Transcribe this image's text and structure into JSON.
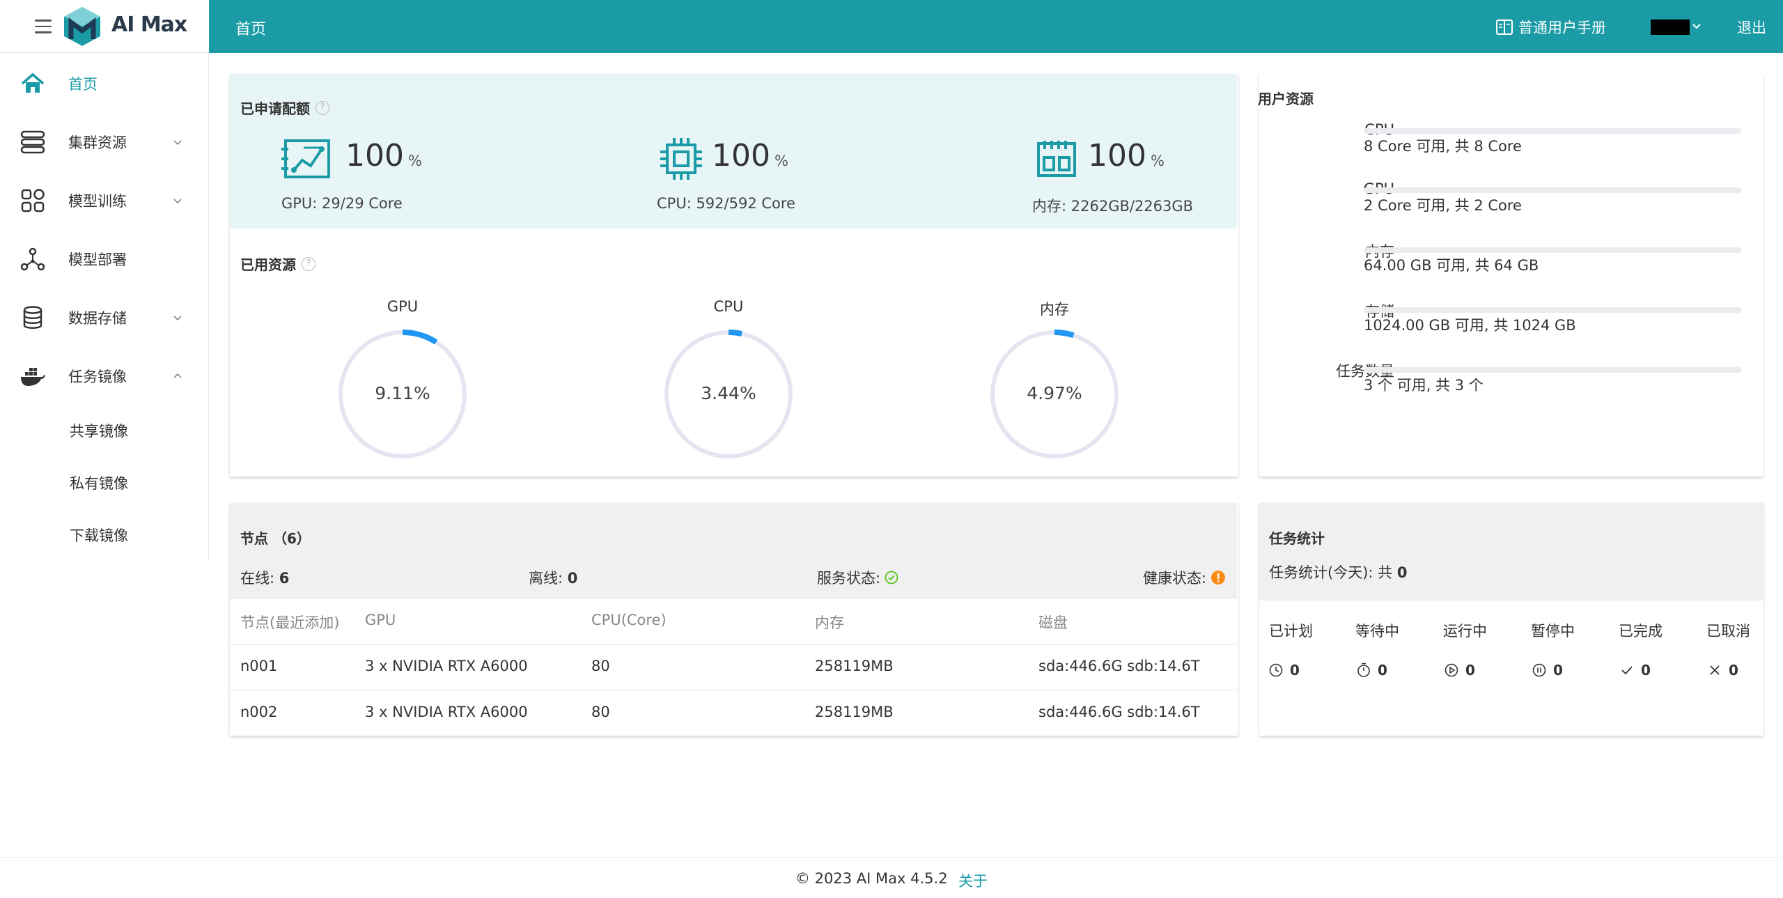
{
  "app": {
    "brand": "AI Max"
  },
  "header": {
    "home": "首页",
    "manual": "普通用户手册",
    "logout": "退出"
  },
  "sidebar": {
    "items": [
      {
        "label": "首页",
        "icon": "home-icon",
        "active": true
      },
      {
        "label": "集群资源",
        "icon": "server-icon"
      },
      {
        "label": "模型训练",
        "icon": "grid-icon"
      },
      {
        "label": "模型部署",
        "icon": "network-icon"
      },
      {
        "label": "数据存储",
        "icon": "database-icon"
      },
      {
        "label": "任务镜像",
        "icon": "docker-icon"
      }
    ],
    "subitems": [
      "共享镜像",
      "私有镜像",
      "下载镜像"
    ]
  },
  "quota": {
    "title": "已申请配额",
    "items": [
      {
        "pct": "100",
        "unit": "%",
        "sub": "GPU: 29/29 Core",
        "icon": "gpu-chart-icon"
      },
      {
        "pct": "100",
        "unit": "%",
        "sub": "CPU: 592/592 Core",
        "icon": "cpu-chip-icon"
      },
      {
        "pct": "100",
        "unit": "%",
        "sub": "内存: 2262GB/2263GB",
        "icon": "memory-icon"
      }
    ]
  },
  "used": {
    "title": "已用资源",
    "gauges": [
      {
        "label": "GPU",
        "value": "9.11%",
        "fraction": 0.0911
      },
      {
        "label": "CPU",
        "value": "3.44%",
        "fraction": 0.0344
      },
      {
        "label": "内存",
        "value": "4.97%",
        "fraction": 0.0497
      }
    ]
  },
  "user_resources": {
    "title": "用户资源",
    "rows": [
      {
        "label": "CPU",
        "text": "8 Core 可用, 共 8 Core"
      },
      {
        "label": "GPU",
        "text": "2 Core 可用, 共 2 Core"
      },
      {
        "label": "内存",
        "text": "64.00 GB 可用, 共 64 GB"
      },
      {
        "label": "存储",
        "text": "1024.00 GB 可用, 共 1024 GB"
      },
      {
        "label": "任务数量",
        "text": "3 个 可用, 共 3 个"
      }
    ]
  },
  "nodes": {
    "title": "节点 （6）",
    "online_label": "在线:",
    "online": "6",
    "offline_label": "离线:",
    "offline": "0",
    "service_label": "服务状态:",
    "health_label": "健康状态:",
    "columns": [
      "节点(最近添加)",
      "GPU",
      "CPU(Core)",
      "内存",
      "磁盘"
    ],
    "rows": [
      [
        "n001",
        "3 x NVIDIA RTX A6000",
        "80",
        "258119MB",
        "sda:446.6G sdb:14.6T"
      ],
      [
        "n002",
        "3 x NVIDIA RTX A6000",
        "80",
        "258119MB",
        "sda:446.6G sdb:14.6T"
      ]
    ]
  },
  "tasks": {
    "title": "任务统计",
    "today_label": "任务统计(今天): 共",
    "today_total": "0",
    "stats": [
      {
        "label": "已计划",
        "value": "0",
        "icon": "clock-icon"
      },
      {
        "label": "等待中",
        "value": "0",
        "icon": "stopwatch-icon"
      },
      {
        "label": "运行中",
        "value": "0",
        "icon": "play-circle-icon"
      },
      {
        "label": "暂停中",
        "value": "0",
        "icon": "pause-circle-icon"
      },
      {
        "label": "已完成",
        "value": "0",
        "icon": "check-icon"
      },
      {
        "label": "已取消",
        "value": "0",
        "icon": "x-icon"
      }
    ]
  },
  "footer": {
    "copyright": "© 2023 AI Max 4.5.2",
    "about": "关于"
  },
  "colors": {
    "primary": "#1a9ba6",
    "gauge": "#2196f3",
    "ok": "#52c41a",
    "warn": "#fa8c16"
  }
}
